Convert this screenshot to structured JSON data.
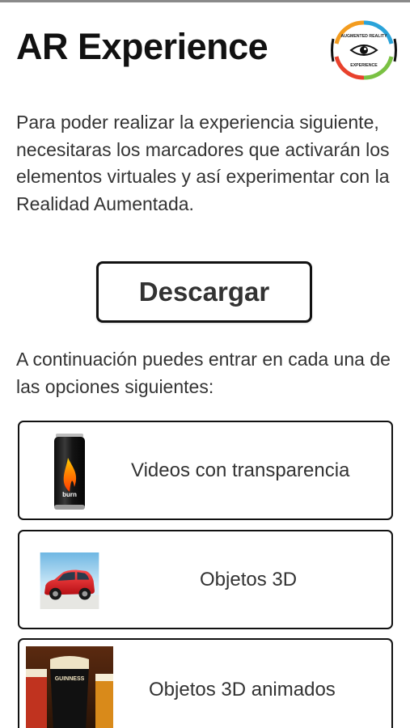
{
  "header": {
    "title": "AR Experience",
    "logo": {
      "icon": "eye-icon",
      "top_text": "AUGMENTED REALITY",
      "bottom_text": "EXPERIENCE",
      "ring_colors": [
        "#2aa3d9",
        "#f39c1f",
        "#e8412c",
        "#7ac143"
      ]
    }
  },
  "intro": {
    "text": "Para poder realizar la experiencia siguiente, necesitaras los marcadores que activarán los elementos virtuales y así experimentar con la Realidad Aumentada."
  },
  "download": {
    "label": "Descargar"
  },
  "subintro": {
    "text": "A continuación puedes entrar en cada una de las opciones siguientes:"
  },
  "options": [
    {
      "label": "Videos con transparencia",
      "thumb": "energy-drink-can-image",
      "thumb_text": "burn"
    },
    {
      "label": "Objetos 3D",
      "thumb": "red-car-image"
    },
    {
      "label": "Objetos 3D animados",
      "thumb": "beer-glasses-image",
      "thumb_text": "GUINNESS"
    }
  ],
  "colors": {
    "text": "#333333",
    "title": "#111111",
    "border": "#111111",
    "background": "#ffffff"
  }
}
